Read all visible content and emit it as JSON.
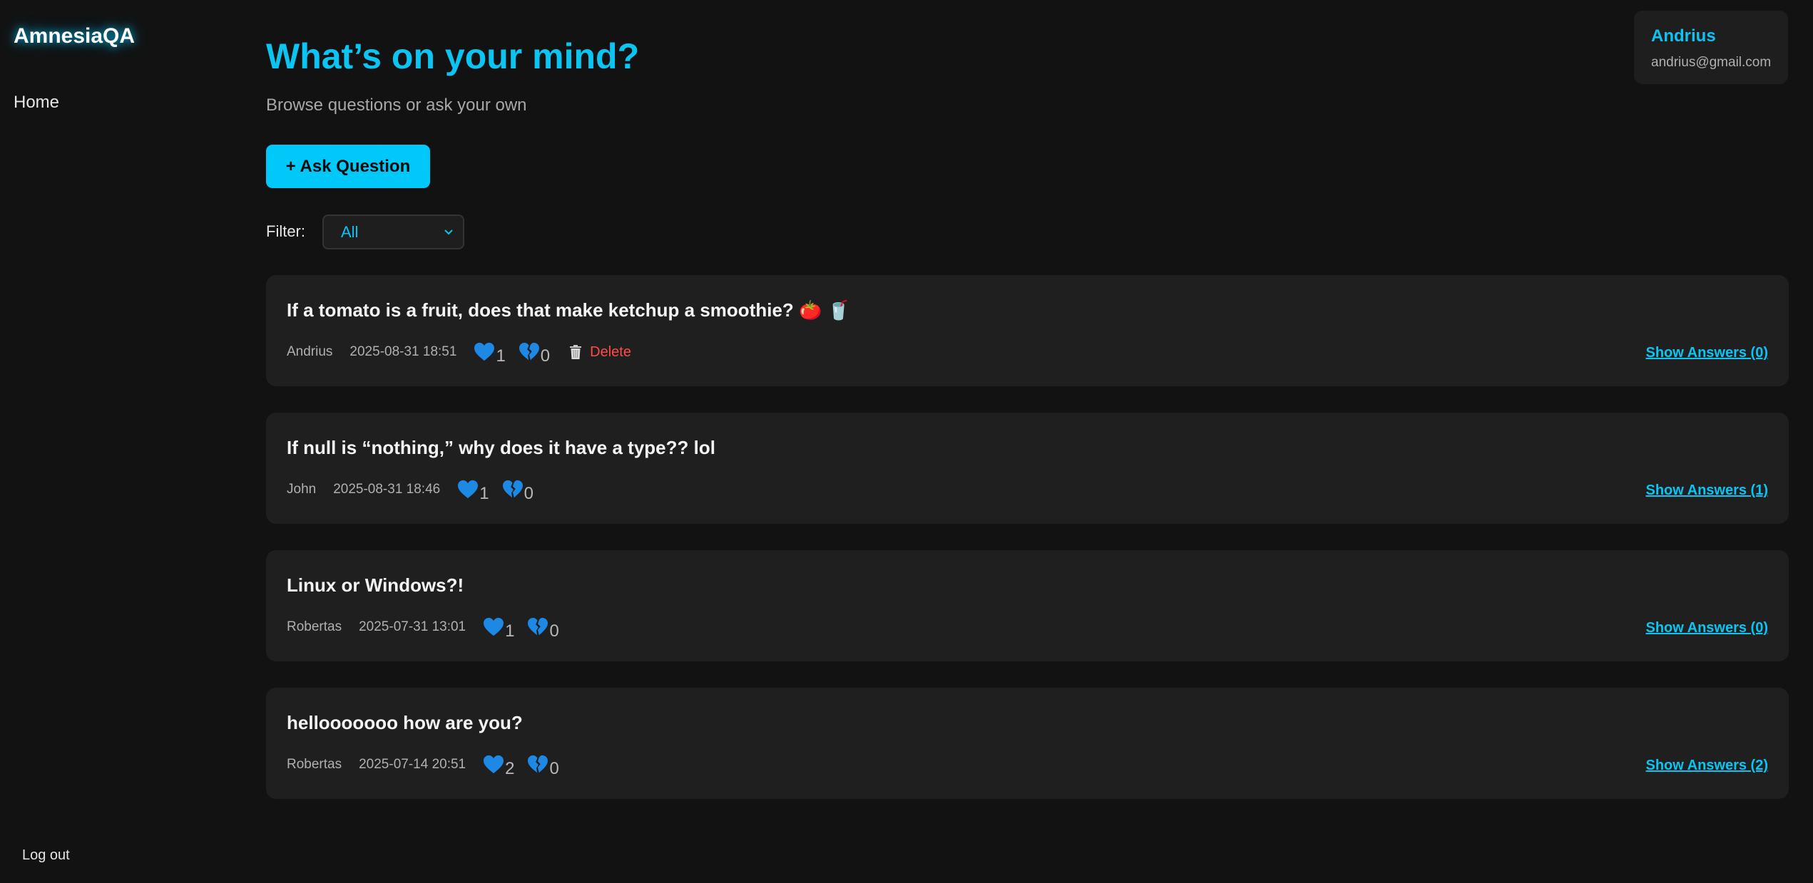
{
  "app": {
    "brand": "AmnesiaQA"
  },
  "sidebar": {
    "home_label": "Home",
    "logout_label": "Log out"
  },
  "header": {
    "title": "What’s on your mind?",
    "subtitle": "Browse questions or ask your own",
    "ask_button": "+ Ask Question",
    "filter_label": "Filter:",
    "filter_value": "All"
  },
  "user": {
    "name": "Andrius",
    "email": "andrius@gmail.com"
  },
  "questions": [
    {
      "title": "If a tomato is a fruit, does that make ketchup a smoothie? 🍅 🥤",
      "author": "Andrius",
      "date": "2025-08-31 18:51",
      "likes": "1",
      "dislikes": "0",
      "delete_label": "Delete",
      "answers_label": "Show Answers (0)"
    },
    {
      "title": "If null is “nothing,” why does it have a type?? lol",
      "author": "John",
      "date": "2025-08-31 18:46",
      "likes": "1",
      "dislikes": "0",
      "answers_label": "Show Answers (1)"
    },
    {
      "title": "Linux or Windows?!",
      "author": "Robertas",
      "date": "2025-07-31 13:01",
      "likes": "1",
      "dislikes": "0",
      "answers_label": "Show Answers (0)"
    },
    {
      "title": "hellooooooo how are you?",
      "author": "Robertas",
      "date": "2025-07-14 20:51",
      "likes": "2",
      "dislikes": "0",
      "answers_label": "Show Answers (2)"
    }
  ],
  "icons": {
    "like": "heart-icon",
    "dislike": "broken-heart-icon",
    "delete": "trash-icon",
    "filter_dropdown": "chevron-down-icon"
  },
  "colors": {
    "accent": "#0bc4f2",
    "button": "#00c8f8",
    "heart": "#1e88e5",
    "danger": "#ff4a4a",
    "background": "#121212",
    "card": "#1f1f1f"
  }
}
